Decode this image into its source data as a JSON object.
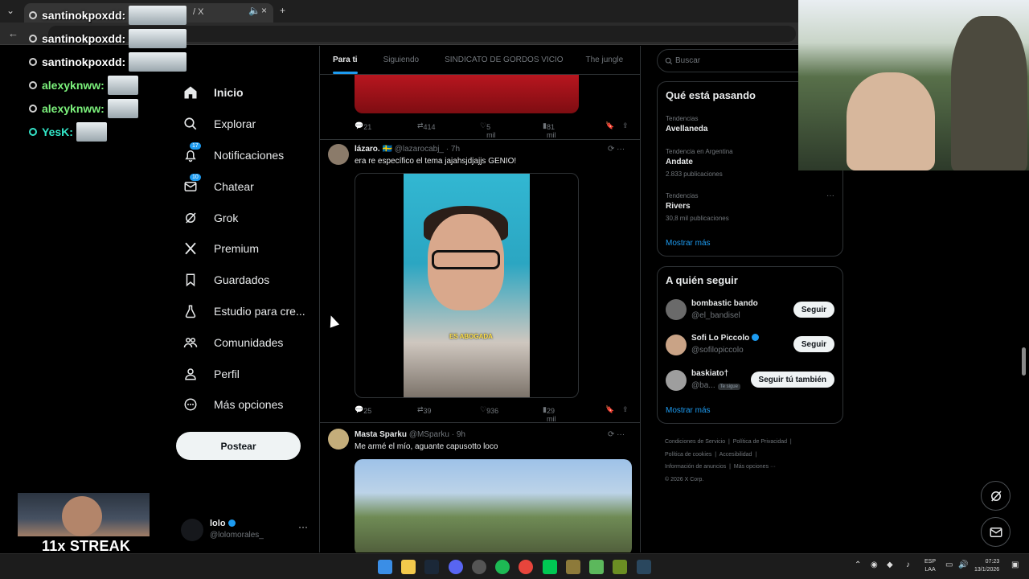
{
  "browser": {
    "tab_title": "/ X",
    "controls": {
      "new_tab": "+",
      "close": "×",
      "back": "←"
    }
  },
  "chat": [
    {
      "name": "santinokpoxdd:",
      "color": "white"
    },
    {
      "name": "santinokpoxdd:",
      "color": "white"
    },
    {
      "name": "santinokpoxdd:",
      "color": "white"
    },
    {
      "name": "alexyknww:",
      "color": "green"
    },
    {
      "name": "alexyknww:",
      "color": "green"
    },
    {
      "name": "YesK:",
      "color": "teal"
    }
  ],
  "nav": {
    "items": [
      {
        "label": "Inicio",
        "icon": "home-icon"
      },
      {
        "label": "Explorar",
        "icon": "search-icon"
      },
      {
        "label": "Notificaciones",
        "icon": "bell-icon",
        "count": "17"
      },
      {
        "label": "Chatear",
        "icon": "mail-icon",
        "count": "10"
      },
      {
        "label": "Grok",
        "icon": "grok-icon"
      },
      {
        "label": "Premium",
        "icon": "x-logo-icon"
      },
      {
        "label": "Guardados",
        "icon": "bookmark-icon"
      },
      {
        "label": "Estudio para cre...",
        "icon": "flask-icon"
      },
      {
        "label": "Comunidades",
        "icon": "people-icon"
      },
      {
        "label": "Perfil",
        "icon": "user-icon"
      },
      {
        "label": "Más opciones",
        "icon": "more-circle-icon"
      }
    ],
    "post_label": "Postear"
  },
  "account": {
    "name": "lolo",
    "handle": "@lolomorales_",
    "more": "···"
  },
  "timeline": {
    "tabs": [
      "Para ti",
      "Siguiendo",
      "SINDICATO DE GORDOS VICIO",
      "The jungle"
    ],
    "posts": [
      {
        "replies": "21",
        "reposts": "414",
        "likes": "5 mil",
        "views": "81 mil"
      },
      {
        "author": "lázaro.",
        "flag": "🇸🇪",
        "handle": "@lazarocabj_",
        "time": "· 7h",
        "text": "era re específico el tema jajahsjdjajjs GENIO!",
        "video_caption": "ES ABOGADA",
        "replies": "25",
        "reposts": "39",
        "likes": "936",
        "views": "29 mil"
      },
      {
        "author": "Masta Sparku",
        "handle": "@MSparku",
        "time": "· 9h",
        "text": "Me armé el mío, aguante capusotto loco"
      }
    ]
  },
  "search": {
    "placeholder": "Buscar"
  },
  "trending": {
    "title": "Qué está pasando",
    "items": [
      {
        "meta": "Tendencias",
        "name": "Avellaneda",
        "count": ""
      },
      {
        "meta": "Tendencia en Argentina",
        "name": "Andate",
        "count": "2.833 publicaciones"
      },
      {
        "meta": "Tendencias",
        "name": "Rivers",
        "count": "30,8 mil publicaciones"
      }
    ],
    "show_more": "Mostrar más",
    "more_dots": "···"
  },
  "who_to_follow": {
    "title": "A quién seguir",
    "users": [
      {
        "name": "bombastic bando",
        "handle": "@el_bandisel",
        "button": "Seguir",
        "verified": false
      },
      {
        "name": "Sofi Lo Piccolo",
        "handle": "@sofilopiccolo",
        "button": "Seguir",
        "verified": true
      },
      {
        "name": "baskiato†",
        "handle": "@ba...",
        "badge": "Te sigue",
        "button": "Seguir tú también",
        "verified": false
      }
    ],
    "show_more": "Mostrar más"
  },
  "footer": {
    "links": [
      "Condiciones de Servicio",
      "Política de Privacidad",
      "Política de cookies",
      "Accesibilidad",
      "Información de anuncios",
      "Más opciones ···"
    ],
    "copyright": "© 2026 X Corp."
  },
  "stream": {
    "streak": "11x STREAK"
  },
  "taskbar": {
    "lang_top": "ESP",
    "lang_bottom": "LAA",
    "time": "07:23",
    "date": "13/1/2026"
  },
  "colors": {
    "accent": "#1d9bf0",
    "background": "#000000",
    "border": "#2f3336"
  }
}
